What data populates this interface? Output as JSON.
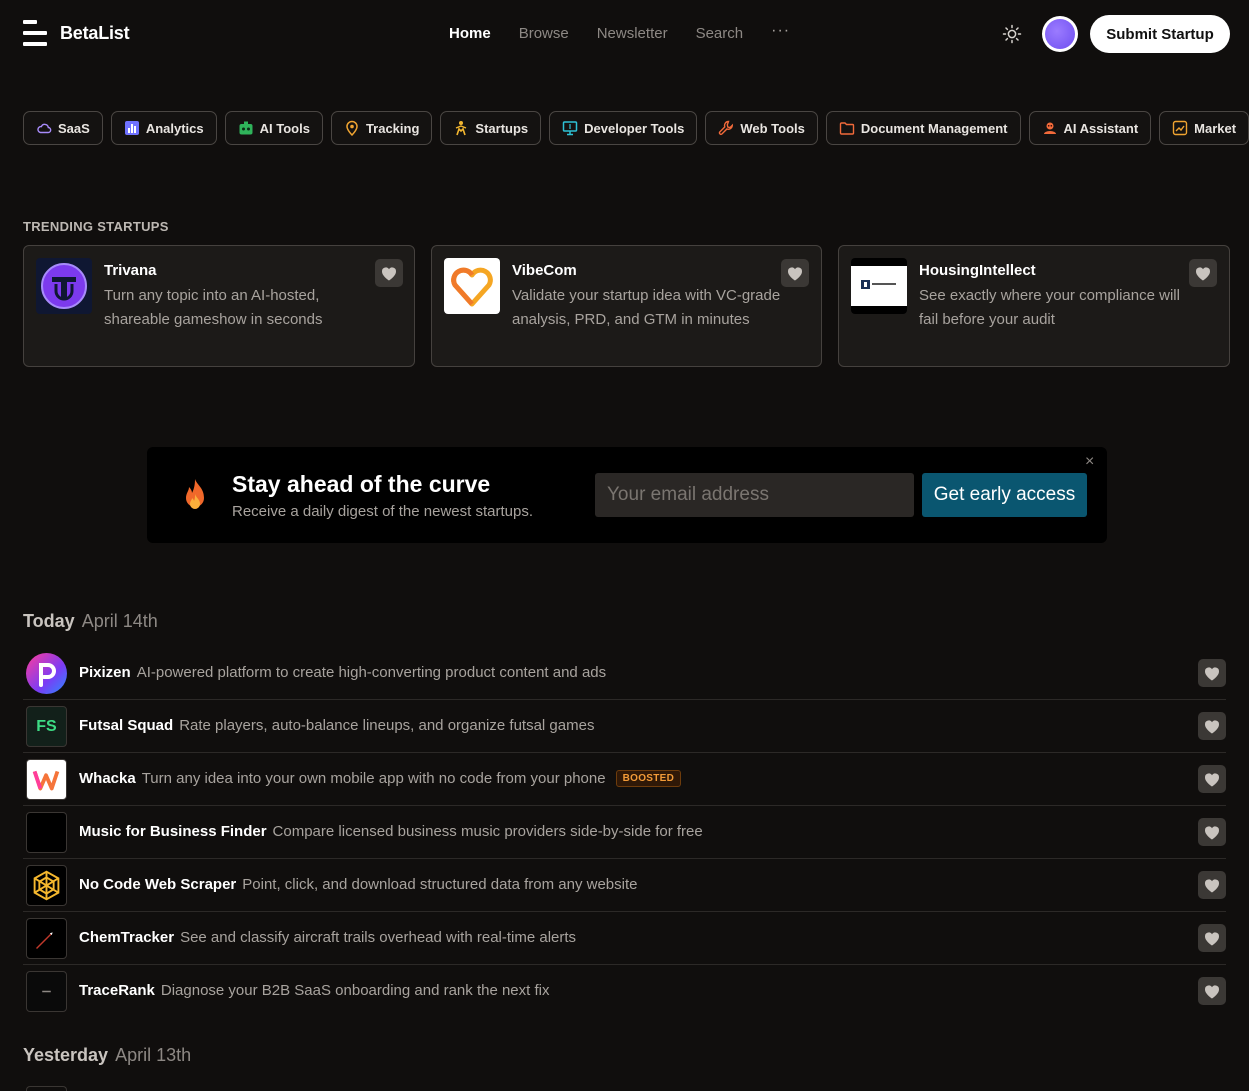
{
  "header": {
    "brand": "BetaList",
    "nav": [
      "Home",
      "Browse",
      "Newsletter",
      "Search"
    ],
    "more": "···",
    "submit_label": "Submit Startup"
  },
  "categories": [
    {
      "label": "SaaS",
      "icon": "cloud-icon",
      "color": "#a78bfa"
    },
    {
      "label": "Analytics",
      "icon": "bar-chart-icon",
      "color": "#6f72ff"
    },
    {
      "label": "AI Tools",
      "icon": "robot-icon",
      "color": "#2fb35a"
    },
    {
      "label": "Tracking",
      "icon": "location-pin-icon",
      "color": "#f0a431"
    },
    {
      "label": "Startups",
      "icon": "rocket-person-icon",
      "color": "#f2b630"
    },
    {
      "label": "Developer Tools",
      "icon": "monitor-icon",
      "color": "#2ec2d6"
    },
    {
      "label": "Web Tools",
      "icon": "wrench-icon",
      "color": "#f26a3a"
    },
    {
      "label": "Document Management",
      "icon": "folder-icon",
      "color": "#f26a3a"
    },
    {
      "label": "AI Assistant",
      "icon": "assistant-icon",
      "color": "#f26a3a"
    },
    {
      "label": "Market",
      "icon": "chart-icon",
      "color": "#f0a431"
    }
  ],
  "trending": {
    "label": "TRENDING STARTUPS",
    "items": [
      {
        "name": "Trivana",
        "desc": "Turn any topic into an AI-hosted, shareable gameshow in seconds",
        "logo": "trivana-logo-icon"
      },
      {
        "name": "VibeCom",
        "desc": "Validate your startup idea with VC-grade analysis, PRD, and GTM in minutes",
        "logo": "vibecom-heart-logo-icon"
      },
      {
        "name": "HousingIntellect",
        "desc": "See exactly where your compliance will fail before your audit",
        "logo": "housingintellect-logo-icon"
      }
    ]
  },
  "newsletter": {
    "title": "Stay ahead of the curve",
    "subtitle": "Receive a daily digest of the newest startups.",
    "placeholder": "Your email address",
    "cta": "Get early access",
    "close": "×"
  },
  "today": {
    "label": "Today",
    "date": "April 14th",
    "items": [
      {
        "name": "Pixizen",
        "desc": "AI-powered platform to create high-converting product content and ads",
        "badge": ""
      },
      {
        "name": "Futsal Squad",
        "desc": "Rate players, auto-balance lineups, and organize futsal games",
        "badge": "",
        "logo_text": "FS"
      },
      {
        "name": "Whacka",
        "desc": "Turn any idea into your own mobile app with no code from your phone",
        "badge": "BOOSTED"
      },
      {
        "name": "Music for Business Finder",
        "desc": "Compare licensed business music providers side-by-side for free",
        "badge": ""
      },
      {
        "name": "No Code Web Scraper",
        "desc": "Point, click, and download structured data from any website",
        "badge": ""
      },
      {
        "name": "ChemTracker",
        "desc": "See and classify aircraft trails overhead with real-time alerts",
        "badge": ""
      },
      {
        "name": "TraceRank",
        "desc": "Diagnose your B2B SaaS onboarding and rank the next fix",
        "badge": ""
      }
    ]
  },
  "yesterday": {
    "label": "Yesterday",
    "date": "April 13th"
  }
}
